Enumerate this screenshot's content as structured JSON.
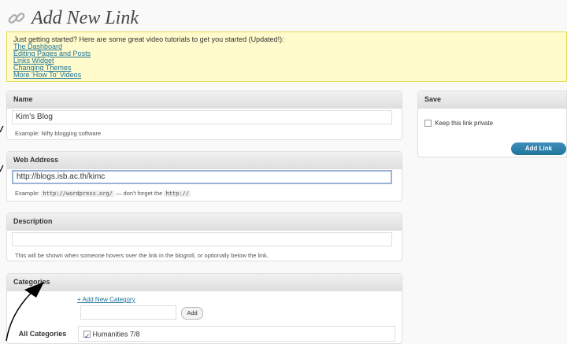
{
  "header": {
    "title": "Add New Link",
    "icon": "link-icon"
  },
  "notice": {
    "text": "Just getting started? Here are some great video tutorials to get you started (Updated!):",
    "links": [
      "The Dashboard",
      "Editing Pages and Posts",
      "Links Widget",
      "Changing Themes",
      "More 'How To' Videos"
    ]
  },
  "name_box": {
    "label": "Name",
    "value": "Kim's Blog",
    "hint": "Example: Nifty blogging software"
  },
  "web_box": {
    "label": "Web Address",
    "value": "http://blogs.isb.ac.th/kimc",
    "hint_prefix": "Example:",
    "hint_code1": "http://wordpress.org/",
    "hint_mid": "— don't forget the",
    "hint_code2": "http://"
  },
  "desc_box": {
    "label": "Description",
    "value": "",
    "hint": "This will be shown when someone hovers over the link in the blogroll, or optionally below the link."
  },
  "categories_box": {
    "label": "Categories",
    "add_link": "+ Add New Category",
    "add_button": "Add",
    "tab": "All Categories",
    "items": [
      {
        "label": "Humanities 7/8",
        "checked": true
      }
    ]
  },
  "save_box": {
    "label": "Save",
    "private_label": "Keep this link private",
    "private_checked": false,
    "button": "Add Link"
  },
  "colors": {
    "accent": "#21759b",
    "notice_bg": "#fffbcc",
    "notice_border": "#e6db55"
  }
}
